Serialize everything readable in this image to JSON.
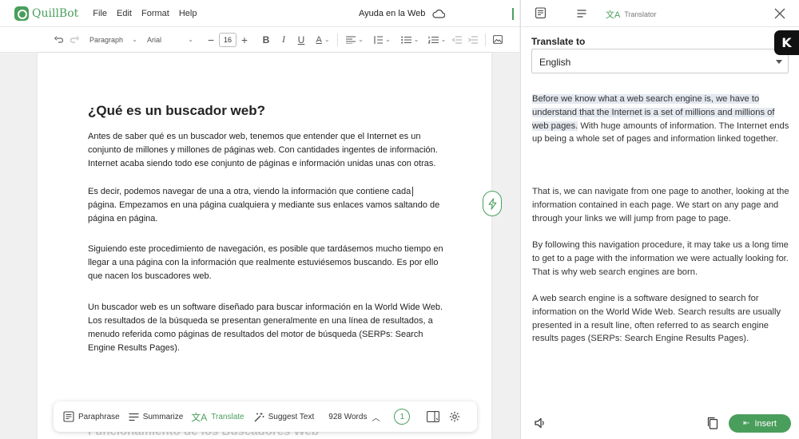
{
  "app": {
    "name": "QuillBot",
    "menu": [
      "File",
      "Edit",
      "Format",
      "Help"
    ],
    "doc_title": "Ayuda en la Web"
  },
  "toolbar": {
    "paragraph_style": "Paragraph",
    "font": "Arial",
    "font_size": "16"
  },
  "document": {
    "heading": "¿Qué es un buscador web?",
    "paragraphs": [
      "Antes de saber qué es un buscador web, tenemos que entender que el Internet es un conjunto de millones y millones de páginas web. Con cantidades ingentes de información. Internet acaba siendo todo ese conjunto de páginas e información unidas unas con otras.",
      "Es decir, podemos navegar de una a otra, viendo la información que contiene cada página. Empezamos en una página cualquiera y mediante sus enlaces vamos saltando de página en página.",
      "Siguiendo este procedimiento de navegación, es posible que tardásemos mucho tiempo en llegar a una página con la información que realmente estuviésemos buscando. Es por ello que nacen los buscadores web.",
      "Un buscador web es un software diseñado para buscar información en la World Wide Web. Los resultados de la búsqueda se presentan generalmente en una línea de resultados, a menudo referida como páginas de resultados del motor de búsqueda (SERPs: Search Engine Results Pages)."
    ],
    "next_heading": "Funcionamiento de los Buscadores Web"
  },
  "bottom_bar": {
    "paraphrase": "Paraphrase",
    "summarize": "Summarize",
    "translate": "Translate",
    "suggest": "Suggest Text",
    "words": "928 Words",
    "count": "1"
  },
  "panel": {
    "tab_translator": "Translator",
    "translate_to_label": "Translate to",
    "language": "English",
    "paragraphs": [
      {
        "highlight": "Before we know what a web search engine is, we have to understand that the Internet is a set of millions and millions of web pages.",
        "rest": " With huge amounts of information. The Internet ends up being a whole set of pages and information linked together."
      },
      {
        "highlight": "",
        "rest": "That is, we can navigate from one page to another, looking at the information contained in each page. We start on any page and through your links we will jump from page to page."
      },
      {
        "highlight": "",
        "rest": "By following this navigation procedure, it may take us a long time to get to a page with the information we were actually looking for. That is why web search engines are born."
      },
      {
        "highlight": "",
        "rest": "A web search engine is a software designed to search for information on the World Wide Web. Search results are usually presented in a result line, often referred to as search engine results pages (SERPs: Search Engine Results Pages)."
      }
    ],
    "insert_label": "Insert",
    "badge_letter": "K"
  },
  "colors": {
    "brand_green": "#4a9e5c",
    "highlight": "#e4e8ef"
  }
}
